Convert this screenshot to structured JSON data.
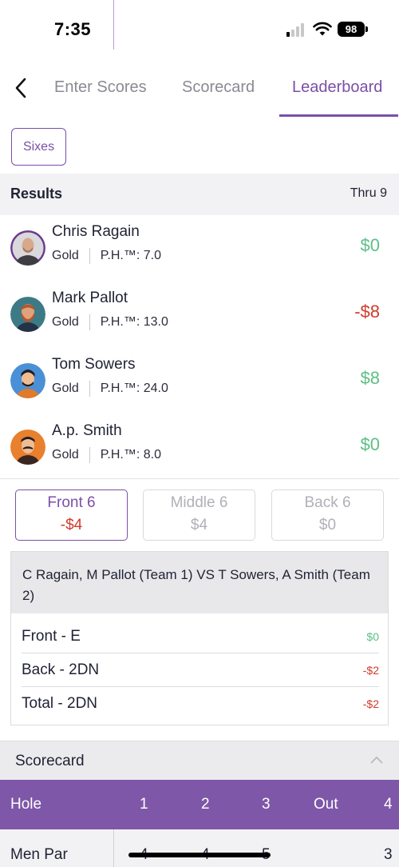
{
  "status_bar": {
    "time": "7:35",
    "battery": "98"
  },
  "nav": {
    "tabs": [
      {
        "label": "Enter Scores",
        "active": false
      },
      {
        "label": "Scorecard",
        "active": false
      },
      {
        "label": "Leaderboard",
        "active": true
      }
    ]
  },
  "game_button": {
    "label": "Sixes"
  },
  "results": {
    "title": "Results",
    "thru": "Thru 9",
    "players": [
      {
        "name": "Chris Ragain",
        "tee": "Gold",
        "ph": "P.H.™: 7.0",
        "amount": "$0",
        "amount_color": "#5cbf86"
      },
      {
        "name": "Mark Pallot",
        "tee": "Gold",
        "ph": "P.H.™: 13.0",
        "amount": "-$8",
        "amount_color": "#d23a2c"
      },
      {
        "name": "Tom Sowers",
        "tee": "Gold",
        "ph": "P.H.™: 24.0",
        "amount": "$8",
        "amount_color": "#5cbf86"
      },
      {
        "name": "A.p. Smith",
        "tee": "Gold",
        "ph": "P.H.™: 8.0",
        "amount": "$0",
        "amount_color": "#5cbf86"
      }
    ]
  },
  "segments": [
    {
      "label": "Front 6",
      "value": "-$4",
      "active": true
    },
    {
      "label": "Middle 6",
      "value": "$4",
      "active": false
    },
    {
      "label": "Back 6",
      "value": "$0",
      "active": false
    }
  ],
  "match": {
    "heading": "C Ragain, M Pallot (Team 1) VS T Sowers, A Smith (Team 2)",
    "rows": [
      {
        "label": "Front - E",
        "value": "$0"
      },
      {
        "label": "Back - 2DN",
        "value": "-$2"
      },
      {
        "label": "Total - 2DN",
        "value": "-$2"
      }
    ]
  },
  "scorecard": {
    "title": "Scorecard",
    "hole_row": {
      "label": "Hole",
      "cells": [
        "1",
        "2",
        "3",
        "Out",
        "4"
      ]
    },
    "par_row": {
      "label": "Men Par",
      "cells": [
        "4",
        "4",
        "5",
        "",
        "3"
      ]
    }
  },
  "colors": {
    "accent": "#7b4fa8",
    "positive": "#5cbf86",
    "negative": "#d23a2c",
    "header_purple": "#7e57a8"
  }
}
